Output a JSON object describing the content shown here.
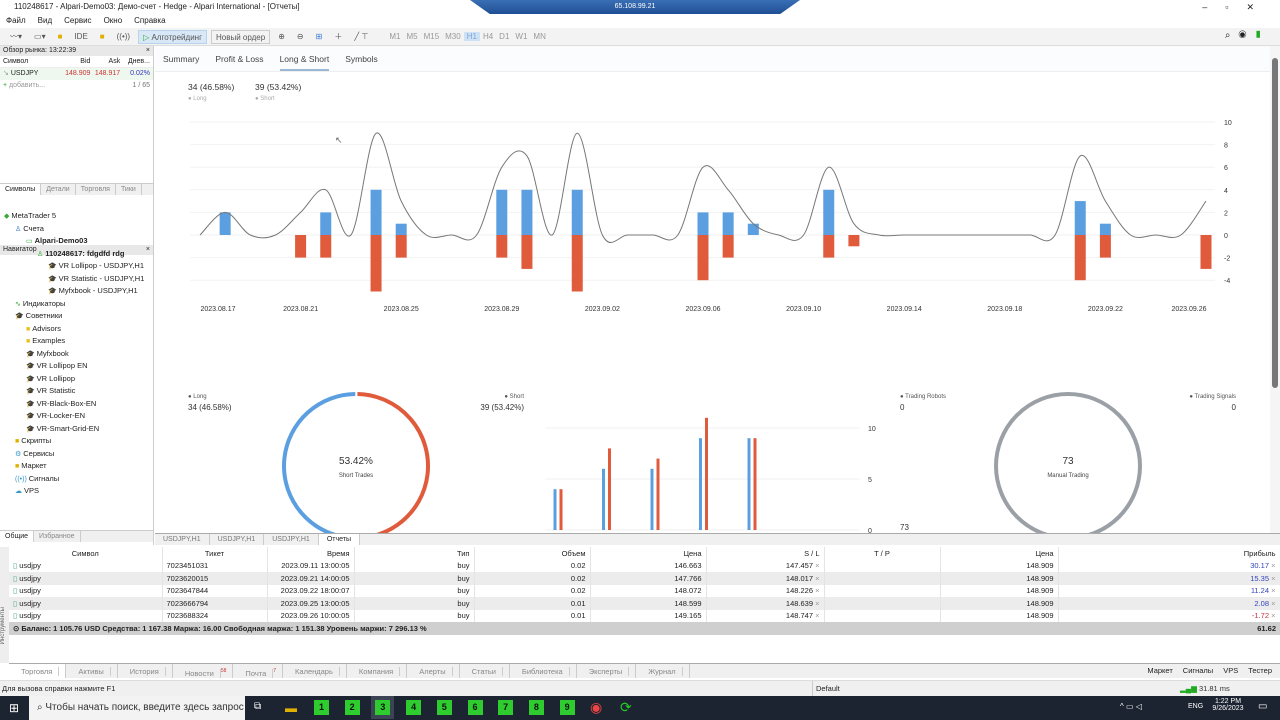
{
  "window": {
    "title": "110248617 - Alpari-Demo03: Демо-счет - Hedge - Alpari International - [Отчеты]",
    "remote_ip": "65.108.99.21"
  },
  "menu": [
    "Файл",
    "Вид",
    "Сервис",
    "Окно",
    "Справка"
  ],
  "toolbar": {
    "ide": "IDE",
    "algotrading": "Алготрейдинг",
    "new_order": "Новый ордер",
    "timeframes": [
      "M1",
      "M5",
      "M15",
      "M30",
      "H1",
      "H4",
      "D1",
      "W1",
      "MN"
    ],
    "selected_timeframe": "H1"
  },
  "market_watch": {
    "title": "Обзор рынка: 13:22:39",
    "columns": [
      "Символ",
      "Bid",
      "Ask",
      "Днев..."
    ],
    "rows": [
      {
        "symbol": "USDJPY",
        "bid": "148.909",
        "ask": "148.917",
        "daily": "0.02%"
      }
    ],
    "add": "добавить...",
    "count": "1 / 65",
    "tabs": [
      "Символы",
      "Детали",
      "Торговля",
      "Тики"
    ]
  },
  "navigator": {
    "title": "Навигатор",
    "items": [
      {
        "label": "MetaTrader 5",
        "level": 0,
        "icon": "metatrader-icon"
      },
      {
        "label": "Счета",
        "level": 1,
        "icon": "accounts-icon"
      },
      {
        "label": "Alpari-Demo03",
        "level": 2,
        "icon": "server-icon",
        "bold": true
      },
      {
        "label": "110248617: fdgdfd rdg",
        "level": 3,
        "icon": "user-icon",
        "bold": true
      },
      {
        "label": "VR Lollipop - USDJPY,H1",
        "level": 4,
        "icon": "expert-icon"
      },
      {
        "label": "VR Statistic - USDJPY,H1",
        "level": 4,
        "icon": "expert-icon"
      },
      {
        "label": "Myfxbook - USDJPY,H1",
        "level": 4,
        "icon": "expert-icon"
      },
      {
        "label": "Индикаторы",
        "level": 1,
        "icon": "indicator-icon"
      },
      {
        "label": "Советники",
        "level": 1,
        "icon": "expert-icon"
      },
      {
        "label": "Advisors",
        "level": 2,
        "icon": "folder-icon"
      },
      {
        "label": "Examples",
        "level": 2,
        "icon": "folder-icon"
      },
      {
        "label": "Myfxbook",
        "level": 2,
        "icon": "expert-icon"
      },
      {
        "label": "VR Lollipop EN",
        "level": 2,
        "icon": "expert-icon"
      },
      {
        "label": "VR Lollipop",
        "level": 2,
        "icon": "expert-icon"
      },
      {
        "label": "VR Statistic",
        "level": 2,
        "icon": "expert-icon"
      },
      {
        "label": "VR-Black-Box-EN",
        "level": 2,
        "icon": "expert-icon"
      },
      {
        "label": "VR-Locker-EN",
        "level": 2,
        "icon": "expert-icon"
      },
      {
        "label": "VR-Smart-Grid-EN",
        "level": 2,
        "icon": "expert-icon"
      },
      {
        "label": "Скрипты",
        "level": 1,
        "icon": "script-icon"
      },
      {
        "label": "Сервисы",
        "level": 1,
        "icon": "gear-icon"
      },
      {
        "label": "Маркет",
        "level": 1,
        "icon": "market-icon"
      },
      {
        "label": "Сигналы",
        "level": 1,
        "icon": "signal-icon"
      },
      {
        "label": "VPS",
        "level": 1,
        "icon": "cloud-icon"
      }
    ],
    "tabs": [
      "Общие",
      "Избранное"
    ]
  },
  "report_tabs": [
    "Summary",
    "Profit & Loss",
    "Long & Short",
    "Symbols"
  ],
  "active_report_tab": "Long & Short",
  "header_stats": {
    "long": "34 (46.58%)",
    "long_label": "Long",
    "short": "39 (53.42%)",
    "short_label": "Short"
  },
  "colors": {
    "long": "#5b9fe0",
    "short": "#e05a3c",
    "total_line": "#777777",
    "gauge": "#9aa0a6"
  },
  "chart_data": [
    {
      "type": "bar",
      "stacked": "diverging",
      "with_line": true,
      "x": [
        "2023.08.18",
        "2023.08.21",
        "2023.08.22",
        "2023.08.24",
        "2023.08.25",
        "2023.08.29",
        "2023.08.30",
        "2023.09.01",
        "2023.09.06",
        "2023.09.07",
        "2023.09.08",
        "2023.09.11",
        "2023.09.12",
        "2023.09.21",
        "2023.09.22",
        "2023.09.26"
      ],
      "series": [
        {
          "name": "Long",
          "values": [
            2,
            0,
            2,
            4,
            1,
            4,
            4,
            4,
            2,
            2,
            1,
            4,
            0,
            3,
            1,
            0
          ]
        },
        {
          "name": "Short",
          "values": [
            0,
            -2,
            -2,
            -5,
            -2,
            -2,
            -3,
            -5,
            -4,
            -2,
            0,
            -2,
            -1,
            -4,
            -2,
            -3
          ]
        }
      ],
      "xlim": [
        "2023.08.17",
        "2023.09.26"
      ],
      "xticks": [
        "2023.08.17",
        "2023.08.21",
        "2023.08.25",
        "2023.08.29",
        "2023.09.02",
        "2023.09.06",
        "2023.09.10",
        "2023.09.14",
        "2023.09.18",
        "2023.09.22",
        "2023.09.26"
      ],
      "yticks": [
        10,
        8,
        6,
        4,
        2,
        0,
        -2,
        -4
      ],
      "ylim": [
        -5,
        10
      ],
      "grid": true
    },
    {
      "type": "pie",
      "donut": true,
      "slices": [
        {
          "name": "Long",
          "value": 34,
          "label": "34 (46.58%)"
        },
        {
          "name": "Short",
          "value": 39,
          "label": "39 (53.42%)"
        }
      ],
      "center_value": "53.42%",
      "center_label": "Short Trades"
    },
    {
      "type": "bar",
      "series": [
        {
          "name": "Long",
          "values": [
            4,
            6,
            6,
            9,
            9
          ]
        },
        {
          "name": "Short",
          "values": [
            4,
            8,
            7,
            11,
            9
          ]
        }
      ],
      "yticks": [
        10,
        5,
        0
      ],
      "ylim": [
        0,
        12
      ],
      "corner_label": "73"
    },
    {
      "type": "pie",
      "donut": true,
      "slices": [
        {
          "name": "Trading Robots",
          "value": 0
        },
        {
          "name": "Manual Trading",
          "value": 73
        },
        {
          "name": "Trading Signals",
          "value": 0
        }
      ],
      "center_value": "73",
      "center_label": "Manual Trading",
      "legend": [
        {
          "name": "Trading Robots",
          "value": "0"
        },
        {
          "name": "Trading Signals",
          "value": "0"
        }
      ]
    }
  ],
  "chart_tabs": [
    "USDJPY,H1",
    "USDJPY,H1",
    "USDJPY,H1",
    "Отчеты"
  ],
  "trades": {
    "columns": [
      "Символ",
      "Тикет",
      "Время",
      "Тип",
      "Объем",
      "Цена",
      "S / L",
      "T / P",
      "Цена",
      "Прибыль"
    ],
    "rows": [
      [
        "usdjpy",
        "7023451031",
        "2023.09.11 13:00:05",
        "buy",
        "0.02",
        "146.663",
        "147.457",
        "",
        "148.909",
        "30.17"
      ],
      [
        "usdjpy",
        "7023620015",
        "2023.09.21 14:00:05",
        "buy",
        "0.02",
        "147.766",
        "148.017",
        "",
        "148.909",
        "15.35"
      ],
      [
        "usdjpy",
        "7023647844",
        "2023.09.22 18:00:07",
        "buy",
        "0.02",
        "148.072",
        "148.226",
        "",
        "148.909",
        "11.24"
      ],
      [
        "usdjpy",
        "7023666794",
        "2023.09.25 13:00:05",
        "buy",
        "0.01",
        "148.599",
        "148.639",
        "",
        "148.909",
        "2.08"
      ],
      [
        "usdjpy",
        "7023688324",
        "2023.09.26 10:00:05",
        "buy",
        "0.01",
        "149.165",
        "148.747",
        "",
        "148.909",
        "-1.72"
      ]
    ],
    "summary": "Баланс: 1 105.76 USD  Средства: 1 167.38  Маржа: 16.00  Свободная маржа: 1 151.38  Уровень маржи: 7 296.13 %",
    "total_profit": "61.62"
  },
  "terminal_tabs": [
    {
      "label": "Торговля"
    },
    {
      "label": "Активы"
    },
    {
      "label": "История"
    },
    {
      "label": "Новости",
      "badge": "58"
    },
    {
      "label": "Почта",
      "badge": "7"
    },
    {
      "label": "Календарь"
    },
    {
      "label": "Компания"
    },
    {
      "label": "Алерты"
    },
    {
      "label": "Статьи"
    },
    {
      "label": "Библиотека"
    },
    {
      "label": "Эксперты"
    },
    {
      "label": "Журнал"
    }
  ],
  "terminal_side_label": "Инструменты",
  "terminal_right": [
    "Маркет",
    "Сигналы",
    "VPS",
    "Тестер"
  ],
  "status": {
    "help": "Для вызова справки нажмите F1",
    "profile": "Default",
    "ping": "31.81 ms"
  },
  "taskbar": {
    "search_placeholder": "Чтобы начать поиск, введите здесь запрос",
    "apps": [
      "1",
      "2",
      "3",
      "4",
      "5",
      "6",
      "7",
      "8",
      "9"
    ],
    "lang": "ENG",
    "time": "1:22 PM",
    "date": "9/26/2023"
  }
}
